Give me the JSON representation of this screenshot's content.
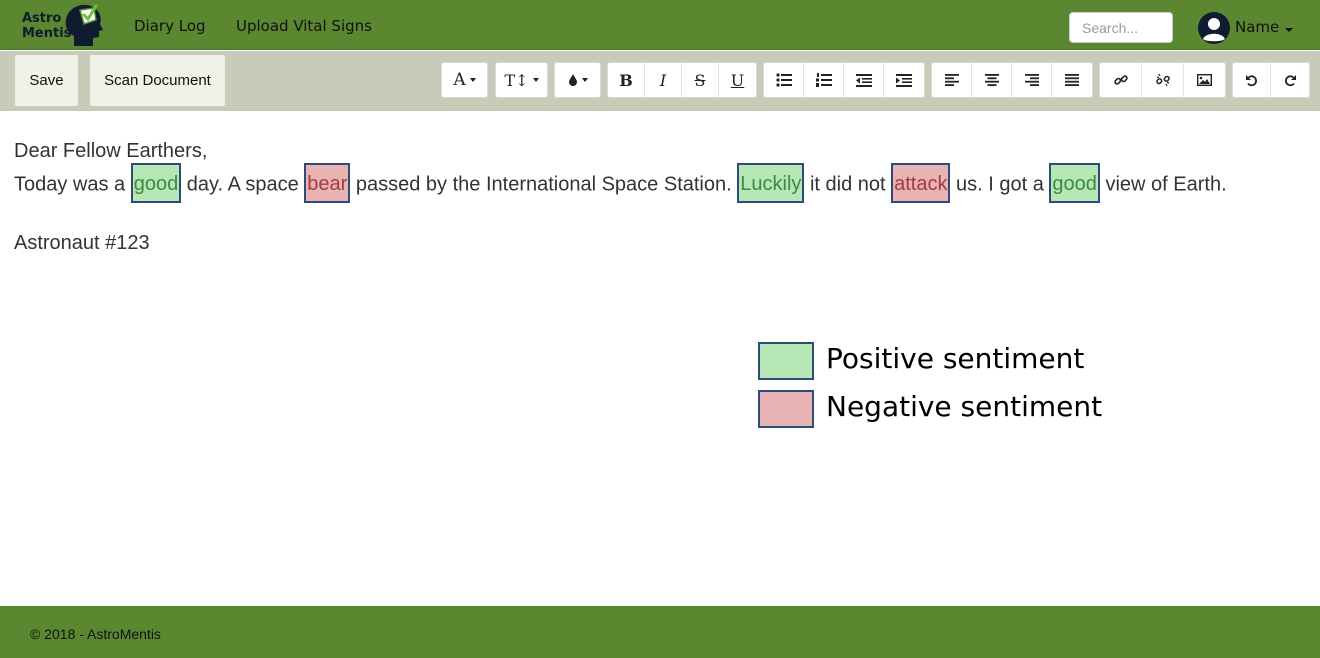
{
  "app": {
    "logo": {
      "line1": "Astro",
      "line2": "Mentis"
    }
  },
  "nav": {
    "links": [
      "Diary Log",
      "Upload Vital Signs"
    ],
    "search_placeholder": "Search...",
    "user_name": "Name"
  },
  "toolbar": {
    "save_label": "Save",
    "scan_label": "Scan Document",
    "font_label": "A",
    "size_label": "T↕",
    "bold": "B",
    "italic": "I",
    "strike": "S",
    "underline": "U",
    "icons": [
      "font-icon",
      "text-size-icon",
      "color-drop-icon",
      "bold-icon",
      "italic-icon",
      "strikethrough-icon",
      "underline-icon",
      "bullet-list-icon",
      "numbered-list-icon",
      "outdent-icon",
      "indent-icon",
      "align-left-icon",
      "align-center-icon",
      "align-right-icon",
      "align-justify-icon",
      "link-icon",
      "unlink-icon",
      "image-icon",
      "undo-icon",
      "redo-icon"
    ]
  },
  "document": {
    "greeting": "Dear Fellow Earthers,",
    "body": [
      {
        "text": "Today was a ",
        "sentiment": "none"
      },
      {
        "text": "good",
        "sentiment": "positive"
      },
      {
        "text": " day. A space ",
        "sentiment": "none"
      },
      {
        "text": "bear",
        "sentiment": "negative"
      },
      {
        "text": " passed by the International Space Station. ",
        "sentiment": "none"
      },
      {
        "text": "Luckily",
        "sentiment": "positive"
      },
      {
        "text": " it did not ",
        "sentiment": "none"
      },
      {
        "text": "attack",
        "sentiment": "negative"
      },
      {
        "text": " us. I got a ",
        "sentiment": "none"
      },
      {
        "text": "good",
        "sentiment": "positive"
      },
      {
        "text": " view of Earth.",
        "sentiment": "none"
      }
    ],
    "signature": "Astronaut #123"
  },
  "legend": {
    "positive": "Positive sentiment",
    "negative": "Negative sentiment",
    "positive_color": "#b8e7b6",
    "negative_color": "#e8b4b3"
  },
  "footer": {
    "text": "© 2018 - AstroMentis"
  },
  "colors": {
    "brand": "#5b8731",
    "toolbar_bg": "#c8cbb8"
  }
}
